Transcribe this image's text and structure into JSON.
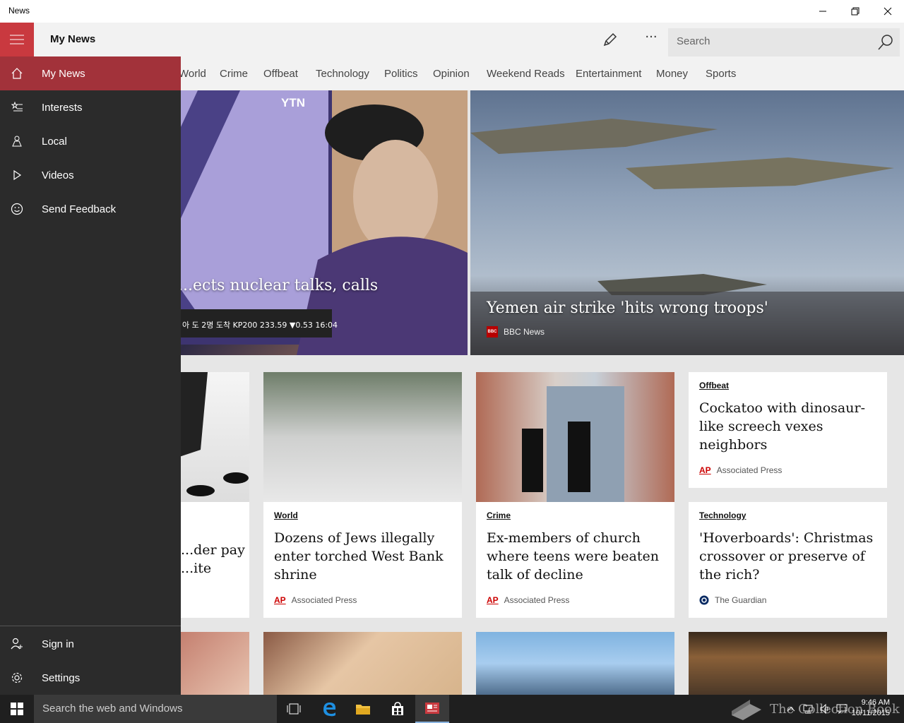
{
  "window": {
    "title": "News"
  },
  "appbar": {
    "title": "My News",
    "search_placeholder": "Search",
    "more_label": "···"
  },
  "categories": [
    "World",
    "Crime",
    "Offbeat",
    "Technology",
    "Politics",
    "Opinion",
    "Weekend Reads",
    "Entertainment",
    "Money",
    "Sports"
  ],
  "drawer": {
    "items": [
      {
        "label": "My News",
        "icon": "home-icon"
      },
      {
        "label": "Interests",
        "icon": "interests-icon"
      },
      {
        "label": "Local",
        "icon": "local-icon"
      },
      {
        "label": "Videos",
        "icon": "play-icon"
      },
      {
        "label": "Send Feedback",
        "icon": "smiley-icon"
      }
    ],
    "bottom": [
      {
        "label": "Sign in",
        "icon": "person-icon"
      },
      {
        "label": "Settings",
        "icon": "gear-icon"
      }
    ]
  },
  "hero": [
    {
      "title": "...ects nuclear talks, calls",
      "image_text": "YTN",
      "ticker": "아 도 2명 도착 KP200 233.59 ▼0.53 16:04"
    },
    {
      "title": "Yemen air strike 'hits wrong troops'",
      "source": "BBC News",
      "source_logo": "BBC"
    }
  ],
  "cards": [
    {
      "title": "...der pay\n...ite"
    },
    {
      "category": "World",
      "title": "Dozens of Jews illegally enter torched West Bank shrine",
      "source": "Associated Press"
    },
    {
      "category": "Crime",
      "title": "Ex-members of church where teens were beaten talk of decline",
      "source": "Associated Press"
    },
    {
      "category": "Offbeat",
      "title": "Cockatoo with dinosaur-like screech vexes neighbors",
      "source": "Associated Press"
    },
    {
      "category": "Technology",
      "title": "'Hoverboards': Christmas crossover or preserve of the rich?",
      "source": "The Guardian"
    }
  ],
  "ap_logo": "AP",
  "taskbar": {
    "search_placeholder": "Search the web and Windows",
    "time": "9:46 AM",
    "date": "10/11/2015",
    "watermark": "The Collection Book"
  },
  "colors": {
    "accent": "#c9393f",
    "drawer": "#2b2b2b",
    "active": "#a2323a",
    "taskbar": "#1f1f1f"
  }
}
